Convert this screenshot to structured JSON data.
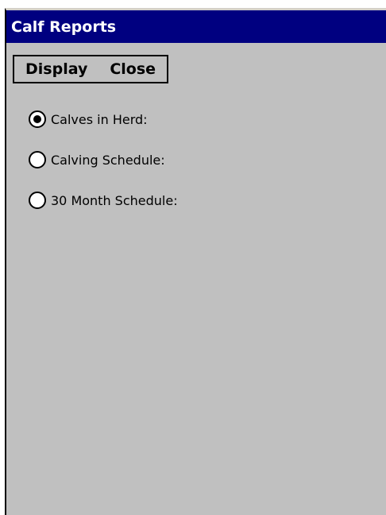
{
  "window": {
    "title": "Calf Reports"
  },
  "menu": {
    "display_label": "Display",
    "close_label": "Close"
  },
  "report_options": [
    {
      "label": "Calves in Herd:",
      "selected": true
    },
    {
      "label": "Calving Schedule:",
      "selected": false
    },
    {
      "label": "30 Month Schedule:",
      "selected": false
    }
  ],
  "colors": {
    "titlebar": "#000080",
    "background": "#c0c0c0",
    "title_text": "#ffffff"
  }
}
